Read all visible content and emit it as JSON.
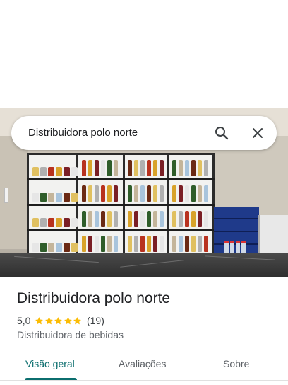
{
  "search": {
    "query": "Distribuidora polo norte"
  },
  "place": {
    "name": "Distribuidora polo norte",
    "rating": "5,0",
    "review_count": "(19)",
    "stars": 5,
    "category": "Distribuidora de bebidas"
  },
  "tabs": [
    {
      "label": "Visão geral",
      "active": true
    },
    {
      "label": "Avaliações",
      "active": false
    },
    {
      "label": "Sobre",
      "active": false
    }
  ],
  "colors": {
    "accent": "#0b6e6e",
    "star": "#fbbc04",
    "text": "#202124",
    "secondary": "#5f6368"
  },
  "icons": {
    "search": "search-icon",
    "close": "close-icon",
    "star": "star-icon"
  }
}
